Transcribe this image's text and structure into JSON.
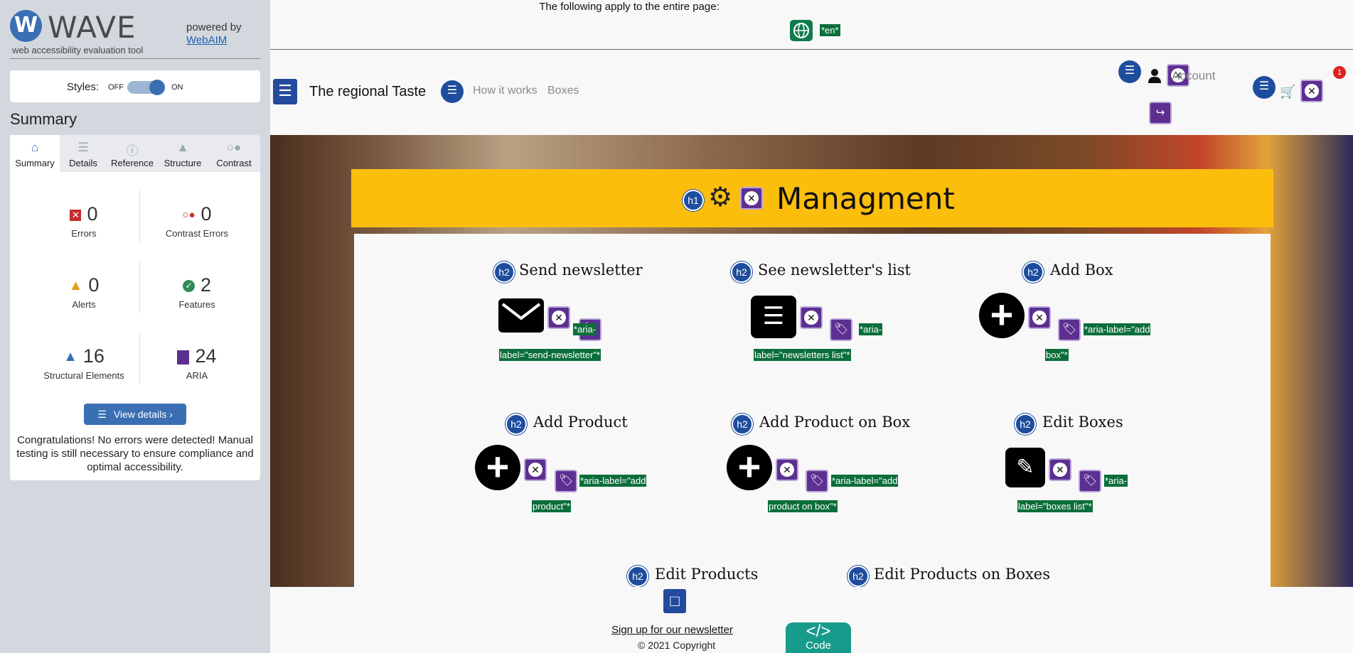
{
  "wave": {
    "logo_letter": "W",
    "logo_text": "WAVE",
    "tagline": "web accessibility evaluation tool",
    "powered_by": "powered by",
    "powered_link": "WebAIM",
    "styles_label": "Styles:",
    "toggle_off": "OFF",
    "toggle_on": "ON",
    "summary_heading": "Summary",
    "tabs": [
      {
        "label": "Summary",
        "icon": "home-icon"
      },
      {
        "label": "Details",
        "icon": "list-icon"
      },
      {
        "label": "Reference",
        "icon": "info-icon"
      },
      {
        "label": "Structure",
        "icon": "structure-icon"
      },
      {
        "label": "Contrast",
        "icon": "contrast-icon"
      }
    ],
    "stats": {
      "errors": {
        "value": "0",
        "label": "Errors"
      },
      "contrast_errors": {
        "value": "0",
        "label": "Contrast Errors"
      },
      "alerts": {
        "value": "0",
        "label": "Alerts"
      },
      "features": {
        "value": "2",
        "label": "Features"
      },
      "structural": {
        "value": "16",
        "label": "Structural Elements"
      },
      "aria": {
        "value": "24",
        "label": "ARIA"
      }
    },
    "view_details": "View details ›",
    "congrats": "Congratulations! No errors were detected! Manual testing is still necessary to ensure compliance and optimal accessibility."
  },
  "page": {
    "apply_text": "The following apply to the entire page:",
    "lang_tag": "*en*",
    "brand": "The regional Taste",
    "nav": [
      "How it works",
      "Boxes"
    ],
    "account": "Account",
    "cart_count": "1",
    "heading_h1": "Managment",
    "h1_badge": "h1",
    "h2_badge": "h2",
    "sections": [
      {
        "title": "Send newsletter",
        "aria_line1": "*aria-",
        "aria_line2": "label=\"send-newsletter\"*"
      },
      {
        "title": "See newsletter's list",
        "aria_line1": "*aria-",
        "aria_line2": "label=\"newsletters list\"*"
      },
      {
        "title": "Add Box",
        "aria_line1": "*aria-label=\"add",
        "aria_line2": "box\"*"
      },
      {
        "title": "Add Product",
        "aria_line1": "*aria-label=\"add",
        "aria_line2": "product\"*"
      },
      {
        "title": "Add Product on Box",
        "aria_line1": "*aria-label=\"add",
        "aria_line2": "product on box\"*"
      },
      {
        "title": "Edit Boxes",
        "aria_line1": "*aria-",
        "aria_line2": "label=\"boxes list\"*"
      },
      {
        "title": "Edit Products"
      },
      {
        "title": "Edit Products on Boxes"
      }
    ],
    "footer_link": "Sign up for our newsletter",
    "copyright": "© 2021 Copyright",
    "code_symbol": "</>",
    "code_label": "Code"
  },
  "colors": {
    "wave_blue": "#3a6fb3",
    "aria_purple": "#5c2f91",
    "label_green": "#0b6e3a",
    "banner_yellow": "#fbbe0d",
    "error_red": "#c32d2d",
    "code_teal": "#179b8b"
  }
}
